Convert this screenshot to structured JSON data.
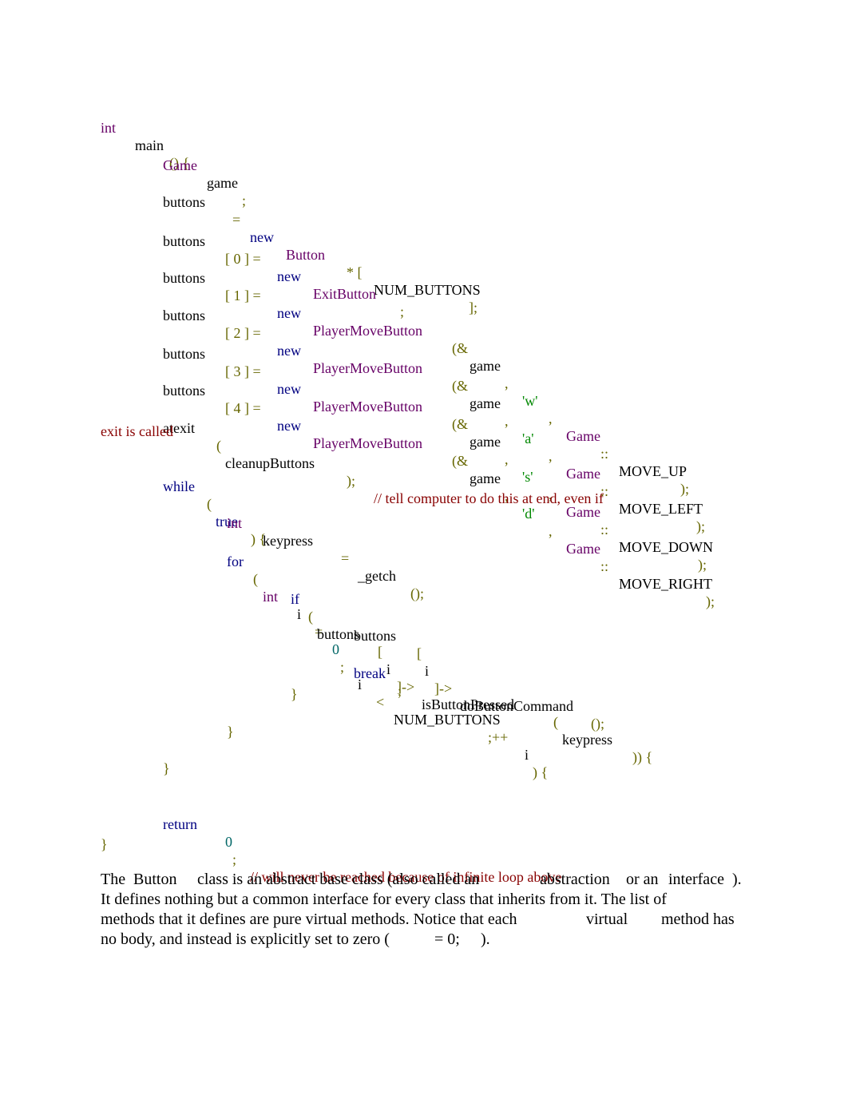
{
  "code": {
    "l1": {
      "int": "int",
      "main": "main",
      "paren": "() {"
    },
    "l2": {
      "type": "Game",
      "name": "game",
      "semi": ";"
    },
    "l3": {
      "name": "buttons",
      "eq": "=",
      "new": "new",
      "type": "Button",
      "br": "* [",
      "const": "NUM_BUTTONS",
      "end": "];"
    },
    "l4": {
      "name": "buttons",
      "idx": "[ 0 ] =",
      "new": "new",
      "type": "ExitButton",
      "semi": ";"
    },
    "l5": {
      "name": "buttons",
      "idx": "[ 1 ] =",
      "new": "new",
      "type": "PlayerMoveButton",
      "amp": "(&",
      "game": "game",
      "c1": ",",
      "ch": "'w'",
      "c2": ",",
      "ns": "Game",
      "scope": "::",
      "val": "MOVE_UP",
      "end": ");"
    },
    "l6": {
      "name": "buttons",
      "idx": "[ 2 ] =",
      "new": "new",
      "type": "PlayerMoveButton",
      "amp": "(&",
      "game": "game",
      "c1": ",",
      "ch": "'a'",
      "c2": ",",
      "ns": "Game",
      "scope": "::",
      "val": "MOVE_LEFT",
      "end": ");"
    },
    "l7": {
      "name": "buttons",
      "idx": "[ 3 ] =",
      "new": "new",
      "type": "PlayerMoveButton",
      "amp": "(&",
      "game": "game",
      "c1": ",",
      "ch": "'s'",
      "c2": ",",
      "ns": "Game",
      "scope": "::",
      "val": "MOVE_DOWN",
      "end": ");"
    },
    "l8": {
      "name": "buttons",
      "idx": "[ 4 ] =",
      "new": "new",
      "type": "PlayerMoveButton",
      "amp": "(&",
      "game": "game",
      "c1": ",",
      "ch": "'d'",
      "c2": ",",
      "ns": "Game",
      "scope": "::",
      "val": "MOVE_RIGHT",
      "end": ");"
    },
    "l9": {
      "fn": "atexit",
      "open": "(",
      "arg": "cleanupButtons",
      "close": ");",
      "comment": "// tell computer to do this at end, even if",
      "comment_wrap": "exit is called"
    },
    "l10": {
      "kw": "while",
      "open": "(",
      "val": "true",
      "close": ") {"
    },
    "l11": {
      "type": "int",
      "name": "keypress",
      "eq": "=",
      "fn": "_getch",
      "call": "();"
    },
    "l12": {
      "kw": "for",
      "open": "(",
      "type": "int",
      "i1": "i",
      "eq": "=",
      "zero": "0",
      "semi": ";",
      "i2": "i",
      "lt": "<",
      "const": "NUM_BUTTONS",
      "inc": ";++",
      "i3": "i",
      "close": ") {"
    },
    "l13": {
      "kw": "if",
      "open": "(",
      "name": "buttons",
      "idx_open": "[",
      "i": "i",
      "arrow": "]->",
      "fn": "isButtonPressed",
      "open2": "(",
      "arg": "keypress",
      "close": ")) {"
    },
    "l14": {
      "name": "buttons",
      "idx_open": "[",
      "i": "i",
      "arrow": "]->",
      "fn": "doButtonCommand",
      "call": "();"
    },
    "l15": {
      "kw": "break",
      "semi": ";"
    },
    "l16": {
      "brace": "}"
    },
    "l17": {
      "brace": "}"
    },
    "l18": {
      "brace": "}"
    },
    "l19": {
      "kw": "return",
      "zero": "0",
      "semi": ";",
      "comment": "// will never be reached because of infinite loop above"
    },
    "l20": {
      "brace": "}"
    }
  },
  "prose": {
    "r1": {
      "a": "The",
      "b": "Button",
      "c": "class is an abstract base class (also called an",
      "d": "abstraction",
      "e": "or an",
      "f": "interface",
      "g": ")."
    },
    "r2": "It defines nothing but a common interface for every class that inherits from it. The list of",
    "r3": {
      "a": "methods that it defines are pure virtual methods. Notice that each",
      "b": "virtual",
      "c": "method has"
    },
    "r4": {
      "a": "no body, and instead is explicitly set to zero (",
      "b": "= 0;",
      "c": ")."
    }
  }
}
